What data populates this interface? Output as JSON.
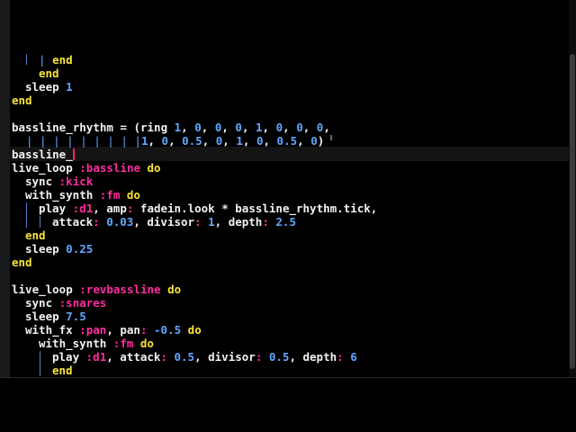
{
  "lines": [
    [
      {
        "t": "| ",
        "c": "g"
      },
      {
        "t": "end",
        "c": "k"
      }
    ],
    [
      {
        "t": "end",
        "c": "k"
      }
    ],
    [
      {
        "t": "sleep ",
        "c": "t"
      },
      {
        "t": "1",
        "c": "n"
      }
    ],
    [
      {
        "t": "end",
        "c": "k"
      }
    ],
    [],
    [
      {
        "t": "bassline_rhythm = (ring ",
        "c": "t"
      },
      {
        "t": "1",
        "c": "n"
      },
      {
        "t": ", ",
        "c": "t"
      },
      {
        "t": "0",
        "c": "n"
      },
      {
        "t": ", ",
        "c": "t"
      },
      {
        "t": "0",
        "c": "n"
      },
      {
        "t": ", ",
        "c": "t"
      },
      {
        "t": "0",
        "c": "n"
      },
      {
        "t": ", ",
        "c": "t"
      },
      {
        "t": "1",
        "c": "n"
      },
      {
        "t": ", ",
        "c": "t"
      },
      {
        "t": "0",
        "c": "n"
      },
      {
        "t": ", ",
        "c": "t"
      },
      {
        "t": "0",
        "c": "n"
      },
      {
        "t": ", ",
        "c": "t"
      },
      {
        "t": "0",
        "c": "n"
      },
      {
        "t": ",",
        "c": "t"
      }
    ],
    [
      {
        "t": "| | | | | | | | |",
        "c": "g"
      },
      {
        "t": "1",
        "c": "n"
      },
      {
        "t": ", ",
        "c": "t"
      },
      {
        "t": "0",
        "c": "n"
      },
      {
        "t": ", ",
        "c": "t"
      },
      {
        "t": "0.5",
        "c": "n"
      },
      {
        "t": ", ",
        "c": "t"
      },
      {
        "t": "0",
        "c": "n"
      },
      {
        "t": ", ",
        "c": "t"
      },
      {
        "t": "1",
        "c": "n"
      },
      {
        "t": ", ",
        "c": "t"
      },
      {
        "t": "0",
        "c": "n"
      },
      {
        "t": ", ",
        "c": "t"
      },
      {
        "t": "0.5",
        "c": "n"
      },
      {
        "t": ", ",
        "c": "t"
      },
      {
        "t": "0",
        "c": "n"
      },
      {
        "t": ")",
        "c": "t"
      }
    ],
    [
      {
        "t": "bassline_",
        "c": "t"
      },
      {
        "cursor": true
      }
    ],
    [
      {
        "t": "live_loop ",
        "c": "t"
      },
      {
        "t": ":bassline",
        "c": "s"
      },
      {
        "t": " do",
        "c": "k"
      }
    ],
    [
      {
        "t": "sync ",
        "c": "t"
      },
      {
        "t": ":kick",
        "c": "s"
      }
    ],
    [
      {
        "t": "with_synth ",
        "c": "t"
      },
      {
        "t": ":fm",
        "c": "s"
      },
      {
        "t": " do",
        "c": "k"
      }
    ],
    [
      {
        "t": "play ",
        "c": "t"
      },
      {
        "t": ":d1",
        "c": "s"
      },
      {
        "t": ", amp",
        "c": "t"
      },
      {
        "t": ":",
        "c": "s"
      },
      {
        "t": " fadein.look * bassline_rhythm.tick,",
        "c": "t"
      }
    ],
    [
      {
        "t": "attack",
        "c": "t"
      },
      {
        "t": ":",
        "c": "s"
      },
      {
        "t": " ",
        "c": "t"
      },
      {
        "t": "0.03",
        "c": "n"
      },
      {
        "t": ", divisor",
        "c": "t"
      },
      {
        "t": ":",
        "c": "s"
      },
      {
        "t": " ",
        "c": "t"
      },
      {
        "t": "1",
        "c": "n"
      },
      {
        "t": ", depth",
        "c": "t"
      },
      {
        "t": ":",
        "c": "s"
      },
      {
        "t": " ",
        "c": "t"
      },
      {
        "t": "2.5",
        "c": "n"
      }
    ],
    [
      {
        "t": "end",
        "c": "k"
      }
    ],
    [
      {
        "t": "sleep ",
        "c": "t"
      },
      {
        "t": "0.25",
        "c": "n"
      }
    ],
    [
      {
        "t": "end",
        "c": "k"
      }
    ],
    [],
    [
      {
        "t": "live_loop ",
        "c": "t"
      },
      {
        "t": ":revbassline",
        "c": "s"
      },
      {
        "t": " do",
        "c": "k"
      }
    ],
    [
      {
        "t": "sync ",
        "c": "t"
      },
      {
        "t": ":snares",
        "c": "s"
      }
    ],
    [
      {
        "t": "sleep ",
        "c": "t"
      },
      {
        "t": "7.5",
        "c": "n"
      }
    ],
    [
      {
        "t": "with_fx ",
        "c": "t"
      },
      {
        "t": ":pan",
        "c": "s"
      },
      {
        "t": ", pan",
        "c": "t"
      },
      {
        "t": ":",
        "c": "s"
      },
      {
        "t": " ",
        "c": "t"
      },
      {
        "t": "-0.5",
        "c": "n"
      },
      {
        "t": " do",
        "c": "k"
      }
    ],
    [
      {
        "t": "with_synth ",
        "c": "t"
      },
      {
        "t": ":fm",
        "c": "s"
      },
      {
        "t": " do",
        "c": "k"
      }
    ],
    [
      {
        "t": "play ",
        "c": "t"
      },
      {
        "t": ":d1",
        "c": "s"
      },
      {
        "t": ", attack",
        "c": "t"
      },
      {
        "t": ":",
        "c": "s"
      },
      {
        "t": " ",
        "c": "t"
      },
      {
        "t": "0.5",
        "c": "n"
      },
      {
        "t": ", divisor",
        "c": "t"
      },
      {
        "t": ":",
        "c": "s"
      },
      {
        "t": " ",
        "c": "t"
      },
      {
        "t": "0.5",
        "c": "n"
      },
      {
        "t": ", depth",
        "c": "t"
      },
      {
        "t": ":",
        "c": "s"
      },
      {
        "t": " ",
        "c": "t"
      },
      {
        "t": "6",
        "c": "n"
      }
    ],
    [
      {
        "t": "end",
        "c": "k"
      }
    ]
  ],
  "colors": {
    "text": "#f2f2f2",
    "keyword": "#f7e43a",
    "number": "#62a7ff",
    "symbol": "#ff2da0",
    "guide": "#5a78c8",
    "cursor": "#ff1f78",
    "background": "#000000"
  }
}
